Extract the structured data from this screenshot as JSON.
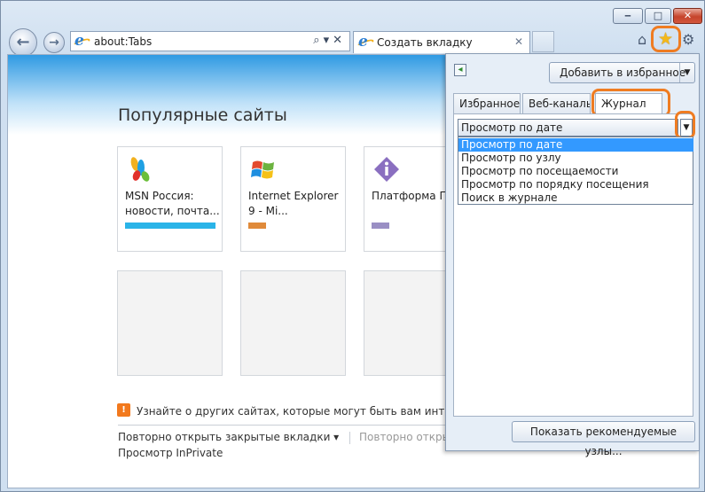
{
  "window": {
    "controls": {
      "minimize_icon": "minimize-icon",
      "maximize_icon": "maximize-icon",
      "close_icon": "close-icon"
    }
  },
  "address_bar": {
    "url": "about:Tabs",
    "tool_glyphs": "⌕▾✕"
  },
  "tabs": [
    {
      "title": "Создать вкладку",
      "close": "✕",
      "active": true
    }
  ],
  "toolbar": {
    "home_icon": "home-icon",
    "favorites_icon": "star-icon",
    "tools_icon": "gear-icon"
  },
  "page": {
    "heading": "Популярные сайты",
    "tiles": [
      {
        "title": "MSN Россия: новости, почта...",
        "bar_color": "#2ab4e8"
      },
      {
        "title": "Internet Explorer 9 - Mi...",
        "bar_color": "#e08a3a"
      },
      {
        "title": "Платформа П",
        "bar_color": "#9a8fc4"
      }
    ],
    "tip": "Узнайте о других сайтах, которые могут быть вам интересны",
    "reopen_closed_tabs": "Повторно открыть закрытые вкладки ▾",
    "reopen_session": "Повторно открыть последний сеанс",
    "inprivate": "Просмотр InPrivate"
  },
  "favorites_panel": {
    "add_button": "Добавить в избранное",
    "add_arrow": "▼",
    "tabs": [
      "Избранное",
      "Веб-каналы",
      "Журнал"
    ],
    "view_select": {
      "value": "Просмотр по дате",
      "arrow": "▼"
    },
    "dropdown_options": [
      "Просмотр по дате",
      "Просмотр по узлу",
      "Просмотр по посещаемости",
      "Просмотр по порядку посещения",
      "Поиск в журнале"
    ],
    "selected_index": 0,
    "show_suggested": "Показать рекомендуемые узлы...",
    "highlight_color": "#ef7c22"
  }
}
